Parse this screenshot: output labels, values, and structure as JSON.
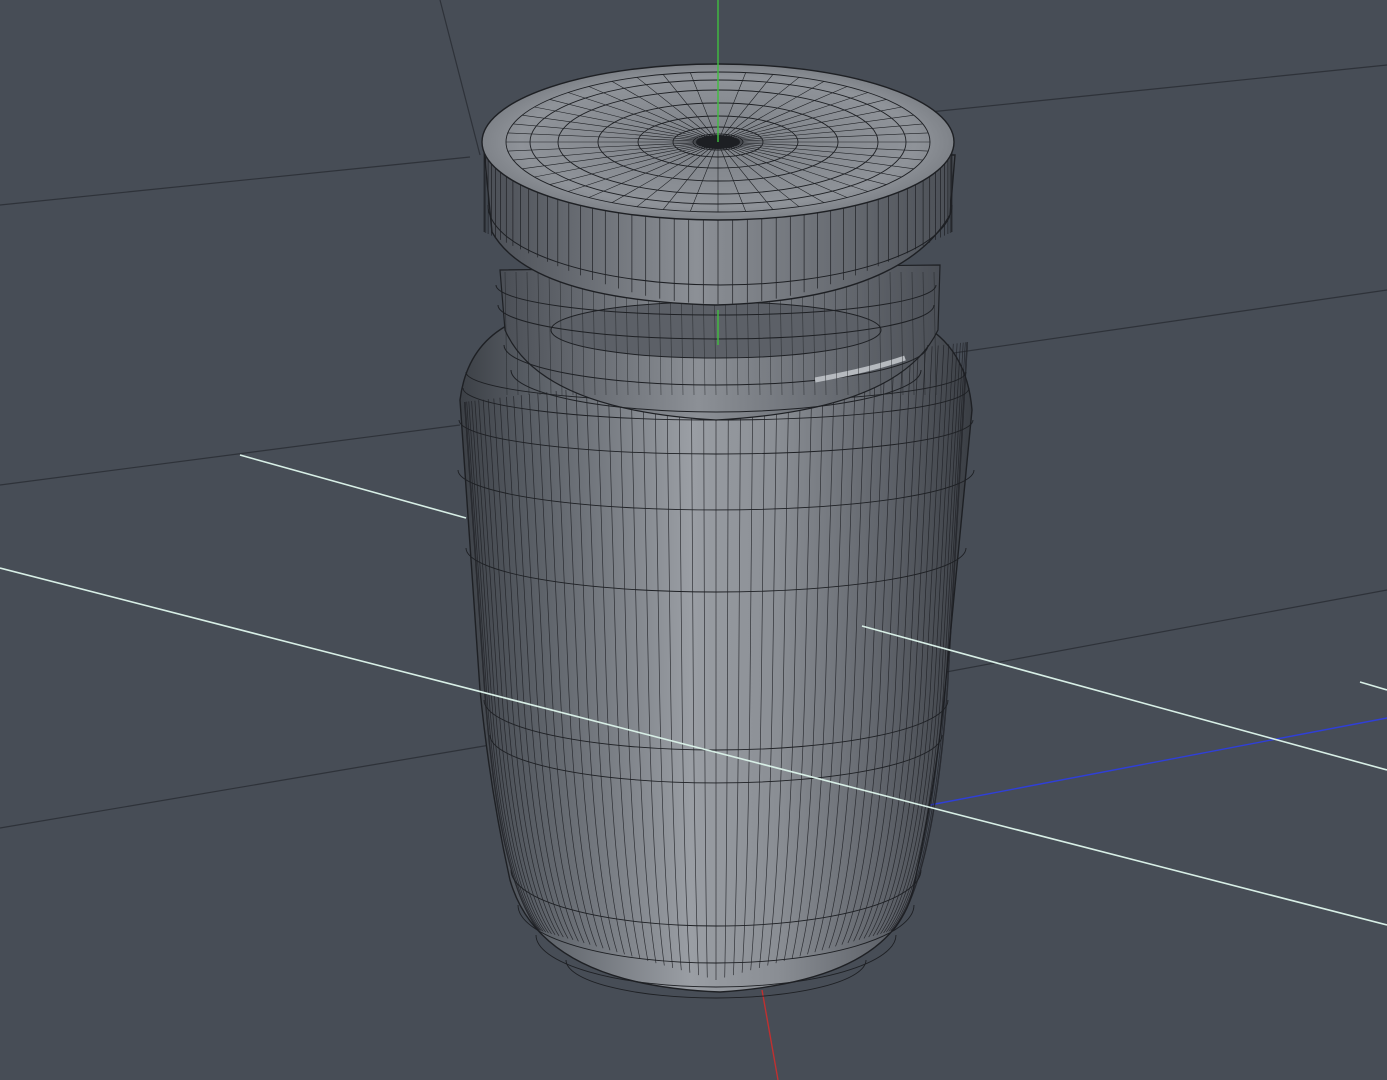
{
  "viewport": {
    "view": "perspective",
    "display_mode": "shaded-wireframe",
    "grid": true
  },
  "scene": {
    "object": "jar-with-screw-lid",
    "parts": [
      "lid",
      "neck-threads",
      "jar-body"
    ]
  },
  "colors": {
    "background": "#474d56",
    "grid_line": "#2e3239",
    "mesh_light": "#9ea2a8",
    "mesh_dark": "#3a3e44",
    "wire": "#1e2024",
    "y_axis": "#3fbf3f",
    "x_axis": "#c03030",
    "z_axis": "#2f3fd8",
    "light_guide": "#d8efe6"
  },
  "icons": {
    "axis_gizmo": "world-origin-axes-icon"
  }
}
